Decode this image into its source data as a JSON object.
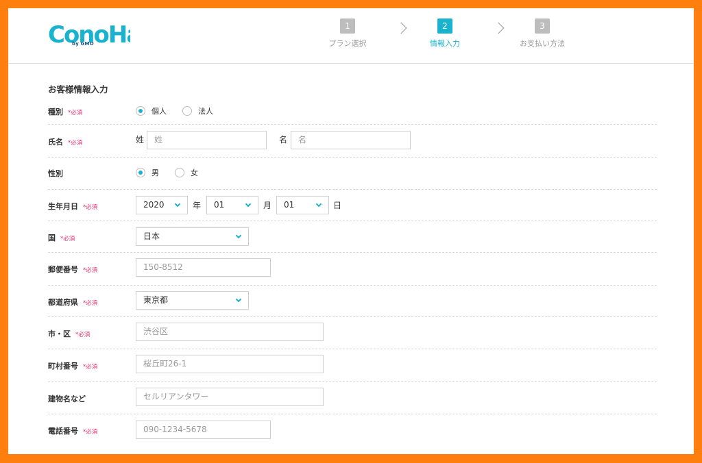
{
  "header": {
    "logo_text": "ConoHa",
    "logo_sub": "by GMO",
    "steps": [
      {
        "number": "1",
        "label": "プラン選択"
      },
      {
        "number": "2",
        "label": "情報入力"
      },
      {
        "number": "3",
        "label": "お支払い方法"
      }
    ]
  },
  "form": {
    "title": "お客様情報入力",
    "required_mark": "*必須",
    "type": {
      "label": "種別",
      "options": [
        "個人",
        "法人"
      ],
      "selected": "個人"
    },
    "name": {
      "label": "氏名",
      "last_prefix": "姓",
      "last_placeholder": "姓",
      "first_prefix": "名",
      "first_placeholder": "名"
    },
    "gender": {
      "label": "性別",
      "options": [
        "男",
        "女"
      ],
      "selected": "男"
    },
    "birthdate": {
      "label": "生年月日",
      "year": "2020",
      "year_unit": "年",
      "month": "01",
      "month_unit": "月",
      "day": "01",
      "day_unit": "日"
    },
    "country": {
      "label": "国",
      "value": "日本"
    },
    "postal": {
      "label": "郵便番号",
      "placeholder": "150-8512"
    },
    "prefecture": {
      "label": "都道府県",
      "value": "東京都"
    },
    "city": {
      "label": "市・区",
      "placeholder": "渋谷区"
    },
    "address": {
      "label": "町村番号",
      "placeholder": "桜丘町26-1"
    },
    "building": {
      "label": "建物名など",
      "placeholder": "セルリアンタワー"
    },
    "phone": {
      "label": "電話番号",
      "placeholder": "090-1234-5678"
    }
  },
  "colors": {
    "accent": "#19b3cf",
    "required": "#e1306c",
    "frame": "#ff7f0e"
  }
}
